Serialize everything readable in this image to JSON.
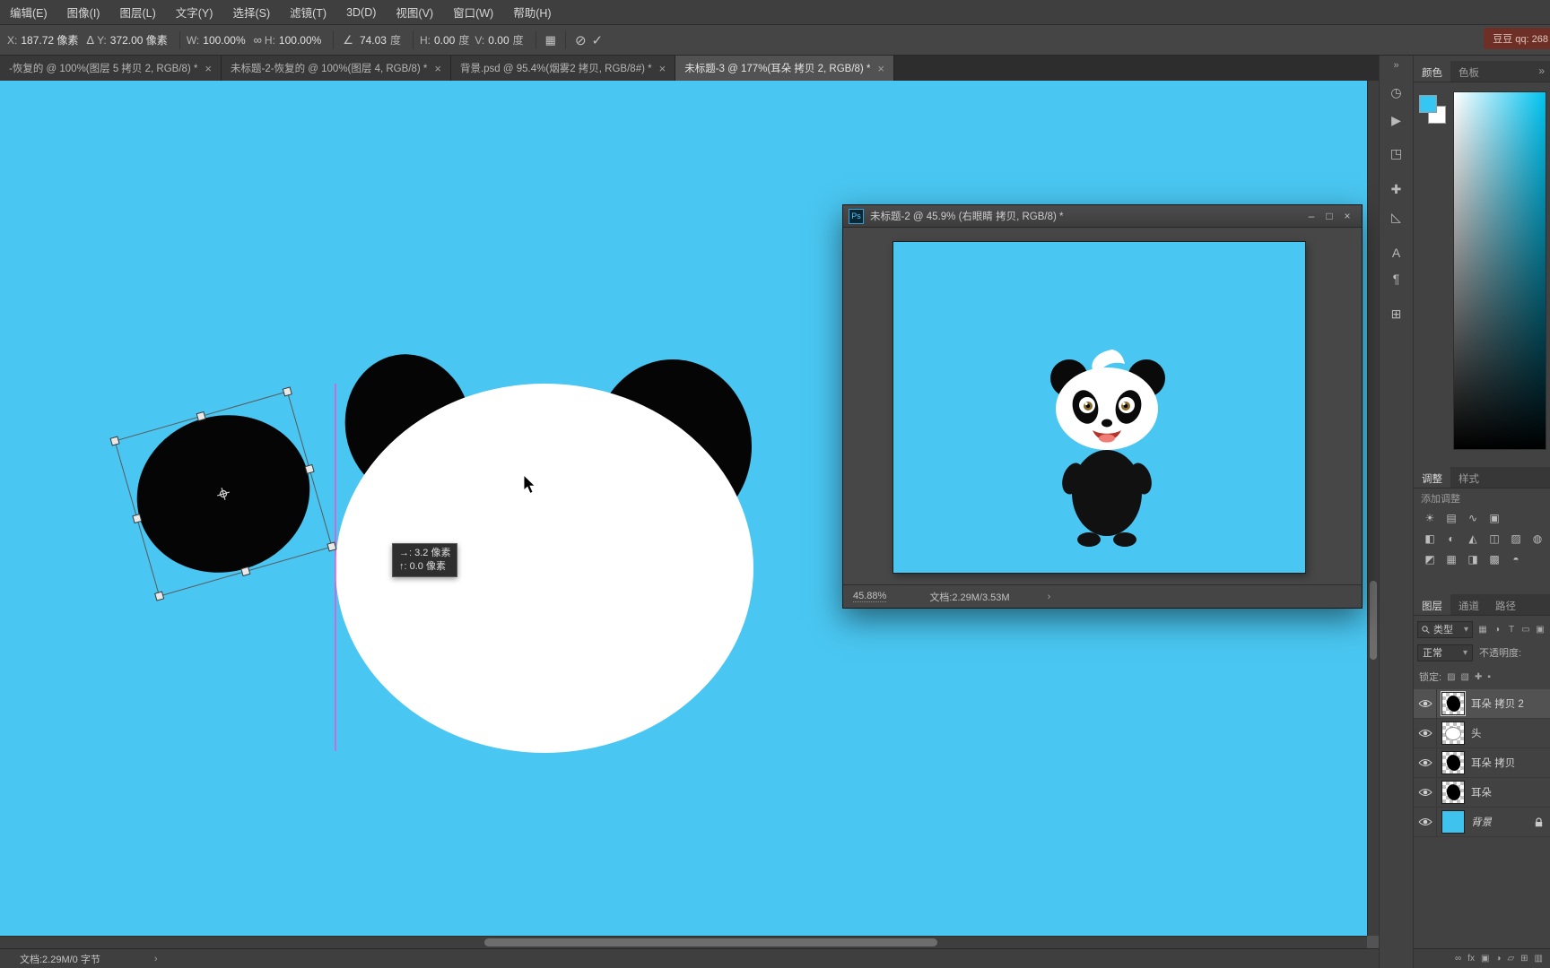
{
  "window": {
    "user_badge": "豆豆 qq: 268"
  },
  "menu": {
    "items": [
      "编辑(E)",
      "图像(I)",
      "图层(L)",
      "文字(Y)",
      "选择(S)",
      "滤镜(T)",
      "3D(D)",
      "视图(V)",
      "窗口(W)",
      "帮助(H)"
    ]
  },
  "options": {
    "x_label": "X:",
    "x_value": "187.72 像素",
    "y_label": "Y:",
    "y_value": "372.00 像素",
    "w_label": "W:",
    "w_value": "100.00%",
    "h_label": "H:",
    "h_value": "100.00%",
    "angle_value": "74.03",
    "angle_unit": "度",
    "skew_h_label": "H:",
    "skew_h_value": "0.00",
    "skew_h_unit": "度",
    "skew_v_label": "V:",
    "skew_v_value": "0.00",
    "skew_v_unit": "度"
  },
  "tabs": [
    {
      "label": "-恢复的 @ 100%(图层 5 拷贝 2, RGB/8) *"
    },
    {
      "label": "未标题-2-恢复的 @ 100%(图层 4, RGB/8) *"
    },
    {
      "label": "背景.psd @ 95.4%(烟雾2 拷贝, RGB/8#) *"
    },
    {
      "label": "未标题-3 @ 177%(耳朵 拷贝 2, RGB/8) *"
    }
  ],
  "canvas": {
    "bg_color": "#49C6F1",
    "tooltip_dx": "→: 3.2 像素",
    "tooltip_dy": "↑: 0.0 像素"
  },
  "float_win": {
    "ps_badge": "Ps",
    "title": "未标题-2 @ 45.9% (右眼睛 拷贝, RGB/8) *",
    "zoom": "45.88%",
    "doc_info": "文档:2.29M/3.53M"
  },
  "color_panel": {
    "tab_color": "颜色",
    "tab_swatches": "色板"
  },
  "adjust_panel": {
    "tab_adjust": "调整",
    "tab_styles": "样式",
    "header": "添加调整",
    "icons": [
      "☀",
      "▤",
      "∿",
      "▣",
      "◧",
      "◐",
      "◭",
      "◫",
      "▨",
      "◍",
      "◩",
      "▦",
      "◨",
      "▩",
      "◓"
    ]
  },
  "layers_panel": {
    "tab_layers": "图层",
    "tab_channels": "通道",
    "tab_paths": "路径",
    "filter_label": "类型",
    "blend_mode": "正常",
    "opacity_label": "不透明度:",
    "lock_label": "锁定:",
    "lock_icons": [
      "▨",
      "▧",
      "✚",
      "▪"
    ],
    "filter_icons": [
      "▦",
      "◑",
      "T",
      "▭",
      "▣"
    ],
    "layers": [
      {
        "name": "耳朵 拷贝 2"
      },
      {
        "name": "头"
      },
      {
        "name": "耳朵 拷贝"
      },
      {
        "name": "耳朵"
      },
      {
        "name": "背景"
      }
    ],
    "footer_icons": [
      "∞",
      "fx",
      "▣",
      "◑",
      "▱",
      "⊞",
      "▥"
    ]
  },
  "statusbar": {
    "doc_info": "文档:2.29M/0 字节"
  },
  "icons": {
    "delta": "Δ",
    "link": "∞",
    "angle": "∠",
    "interp": "▦",
    "cancel": "⊘",
    "commit": "✓",
    "close_tab": "×",
    "collapse": "»",
    "minimize": "–",
    "maximize": "□",
    "close": "×",
    "chevron": "›",
    "dropdown": "▾",
    "history": "◷",
    "actions": "▶",
    "properties": "◳",
    "info": "✚",
    "measure": "◺",
    "character": "A",
    "paragraph": "¶",
    "glyphs": "⊞"
  }
}
